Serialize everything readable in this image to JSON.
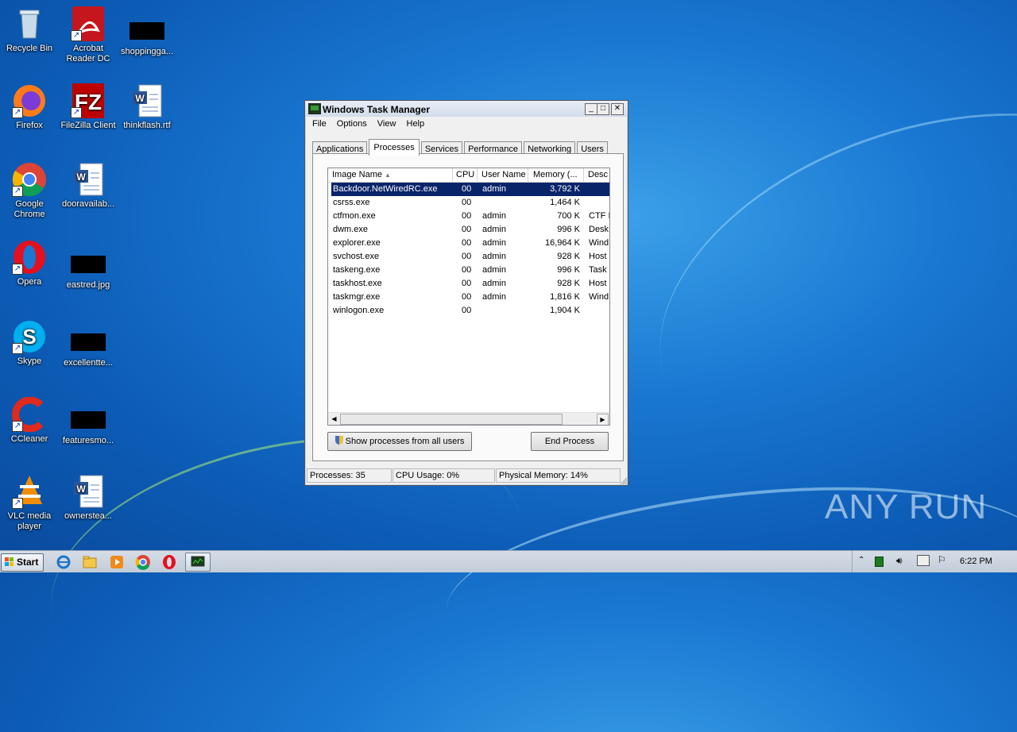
{
  "desktop": {
    "icons": [
      {
        "label": "Recycle Bin",
        "icon": "recycle-bin-icon"
      },
      {
        "label": "Acrobat Reader DC",
        "icon": "acrobat-icon"
      },
      {
        "label": "shoppingga...",
        "icon": "redacted-thumbnail-icon"
      },
      {
        "label": "Firefox",
        "icon": "firefox-icon"
      },
      {
        "label": "FileZilla Client",
        "icon": "filezilla-icon"
      },
      {
        "label": "thinkflash.rtf",
        "icon": "word-document-icon"
      },
      {
        "label": "Google Chrome",
        "icon": "chrome-icon"
      },
      {
        "label": "dooravailab...",
        "icon": "word-document-icon"
      },
      {
        "label": "Opera",
        "icon": "opera-icon"
      },
      {
        "label": "eastred.jpg",
        "icon": "redacted-thumbnail-icon"
      },
      {
        "label": "Skype",
        "icon": "skype-icon"
      },
      {
        "label": "excellentte...",
        "icon": "redacted-thumbnail-icon"
      },
      {
        "label": "CCleaner",
        "icon": "ccleaner-icon"
      },
      {
        "label": "featuresmo...",
        "icon": "redacted-thumbnail-icon"
      },
      {
        "label": "VLC media player",
        "icon": "vlc-icon"
      },
      {
        "label": "ownerstea...",
        "icon": "word-document-icon"
      }
    ]
  },
  "taskmanager": {
    "title": "Windows Task Manager",
    "window_buttons": {
      "minimize": "_",
      "maximize": "□",
      "close": "✕"
    },
    "menu": [
      "File",
      "Options",
      "View",
      "Help"
    ],
    "tabs": [
      "Applications",
      "Processes",
      "Services",
      "Performance",
      "Networking",
      "Users"
    ],
    "active_tab": "Processes",
    "columns": [
      "Image Name",
      "CPU",
      "User Name",
      "Memory (...",
      "Desc"
    ],
    "rows": [
      {
        "name": "Backdoor.NetWiredRC.exe",
        "cpu": "00",
        "user": "admin",
        "mem": "3,792 K",
        "desc": ""
      },
      {
        "name": "csrss.exe",
        "cpu": "00",
        "user": "",
        "mem": "1,464 K",
        "desc": ""
      },
      {
        "name": "ctfmon.exe",
        "cpu": "00",
        "user": "admin",
        "mem": "700 K",
        "desc": "CTF I"
      },
      {
        "name": "dwm.exe",
        "cpu": "00",
        "user": "admin",
        "mem": "996 K",
        "desc": "Desk"
      },
      {
        "name": "explorer.exe",
        "cpu": "00",
        "user": "admin",
        "mem": "16,964 K",
        "desc": "Wind"
      },
      {
        "name": "svchost.exe",
        "cpu": "00",
        "user": "admin",
        "mem": "928 K",
        "desc": "Host"
      },
      {
        "name": "taskeng.exe",
        "cpu": "00",
        "user": "admin",
        "mem": "996 K",
        "desc": "Task"
      },
      {
        "name": "taskhost.exe",
        "cpu": "00",
        "user": "admin",
        "mem": "928 K",
        "desc": "Host"
      },
      {
        "name": "taskmgr.exe",
        "cpu": "00",
        "user": "admin",
        "mem": "1,816 K",
        "desc": "Wind"
      },
      {
        "name": "winlogon.exe",
        "cpu": "00",
        "user": "",
        "mem": "1,904 K",
        "desc": ""
      }
    ],
    "show_all_button": "Show processes from all users",
    "end_process_button": "End Process",
    "status": {
      "processes": "Processes: 35",
      "cpu": "CPU Usage: 0%",
      "memory": "Physical Memory: 14%"
    }
  },
  "taskbar": {
    "start_label": "Start",
    "pinned": [
      "internet-explorer-icon",
      "file-explorer-icon",
      "media-player-icon",
      "chrome-icon",
      "opera-icon",
      "task-manager-icon"
    ],
    "clock": "6:22 PM"
  },
  "watermark": "ANY RUN"
}
